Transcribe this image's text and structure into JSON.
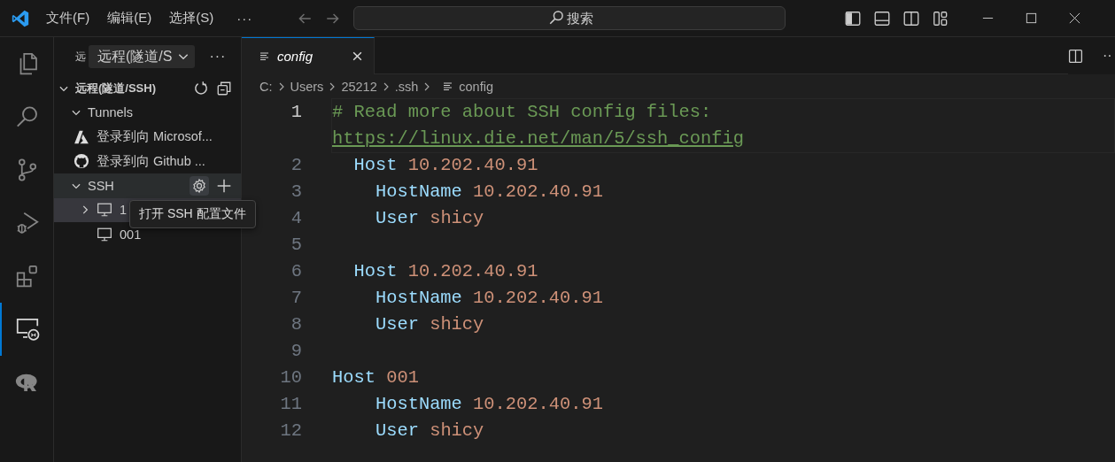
{
  "title_bar": {
    "menus": [
      "文件(F)",
      "编辑(E)",
      "选择(S)"
    ],
    "more": "···",
    "search": {
      "placeholder": "搜索"
    }
  },
  "activity_bar": [
    {
      "kind": "files",
      "selected": false
    },
    {
      "kind": "search",
      "selected": false
    },
    {
      "kind": "source-control",
      "selected": false
    },
    {
      "kind": "run-debug",
      "selected": false
    },
    {
      "kind": "extensions",
      "selected": false
    },
    {
      "kind": "remote",
      "selected": true
    },
    {
      "kind": "r-language",
      "selected": false
    }
  ],
  "sidebar": {
    "title": "远",
    "dropdown": "远程(隧道/S",
    "more": "···",
    "tree": [
      {
        "kind": "section",
        "label": "远程(隧道/SSH)",
        "expanded": true,
        "selected": false,
        "hovered": false,
        "children": [
          {
            "kind": "group",
            "label": "Tunnels",
            "expanded": true,
            "selected": false,
            "hovered": false,
            "children": [
              {
                "kind": "azure",
                "label": "登录到向 Microsof...",
                "selected": false,
                "hovered": false
              },
              {
                "kind": "github",
                "label": "登录到向 Github ...",
                "selected": false,
                "hovered": false
              }
            ]
          },
          {
            "kind": "group",
            "label": "SSH",
            "expanded": true,
            "selected": false,
            "hovered": true,
            "children": [
              {
                "kind": "host",
                "label": "1",
                "expanded": false,
                "selected": true,
                "hovered": false
              },
              {
                "kind": "host",
                "label": "001",
                "selected": false,
                "hovered": false
              }
            ]
          }
        ]
      }
    ],
    "tooltip": "打开 SSH 配置文件"
  },
  "editor": {
    "tabs": [
      {
        "label": "config",
        "selected": true,
        "preview": true
      }
    ],
    "more": "··",
    "breadcrumb": [
      "C:",
      "Users",
      "25212",
      ".ssh",
      "config"
    ],
    "lines": [
      {
        "number": "1",
        "current": true,
        "tokens": [
          {
            "kind": "comment",
            "text": "# Read more about SSH config files:"
          },
          {
            "kind": "link",
            "text": "https://linux.die.net/man/5/ssh_config"
          }
        ]
      },
      {
        "number": "2",
        "current": false,
        "tokens": [
          {
            "kind": "keyword",
            "text": "  Host"
          },
          {
            "kind": "value",
            "text": "10.202.40.91"
          }
        ]
      },
      {
        "number": "3",
        "current": false,
        "tokens": [
          {
            "kind": "keyword",
            "text": "    HostName"
          },
          {
            "kind": "value",
            "text": "10.202.40.91"
          }
        ]
      },
      {
        "number": "4",
        "current": false,
        "tokens": [
          {
            "kind": "keyword",
            "text": "    User"
          },
          {
            "kind": "value",
            "text": "shicy"
          }
        ]
      },
      {
        "number": "5",
        "current": false
      },
      {
        "number": "6",
        "current": false,
        "tokens": [
          {
            "kind": "keyword",
            "text": "  Host"
          },
          {
            "kind": "value",
            "text": "10.202.40.91"
          }
        ]
      },
      {
        "number": "7",
        "current": false,
        "tokens": [
          {
            "kind": "keyword",
            "text": "    HostName"
          },
          {
            "kind": "value",
            "text": "10.202.40.91"
          }
        ]
      },
      {
        "number": "8",
        "current": false,
        "tokens": [
          {
            "kind": "keyword",
            "text": "    User"
          },
          {
            "kind": "value",
            "text": "shicy"
          }
        ]
      },
      {
        "number": "9",
        "current": false
      },
      {
        "number": "10",
        "current": false,
        "tokens": [
          {
            "kind": "keyword",
            "text": "Host"
          },
          {
            "kind": "value",
            "text": "001"
          }
        ]
      },
      {
        "number": "11",
        "current": false,
        "tokens": [
          {
            "kind": "keyword",
            "text": "    HostName"
          },
          {
            "kind": "value",
            "text": "10.202.40.91"
          }
        ]
      },
      {
        "number": "12",
        "current": false,
        "tokens": [
          {
            "kind": "keyword",
            "text": "    User"
          },
          {
            "kind": "value",
            "text": "shicy"
          }
        ]
      }
    ]
  }
}
